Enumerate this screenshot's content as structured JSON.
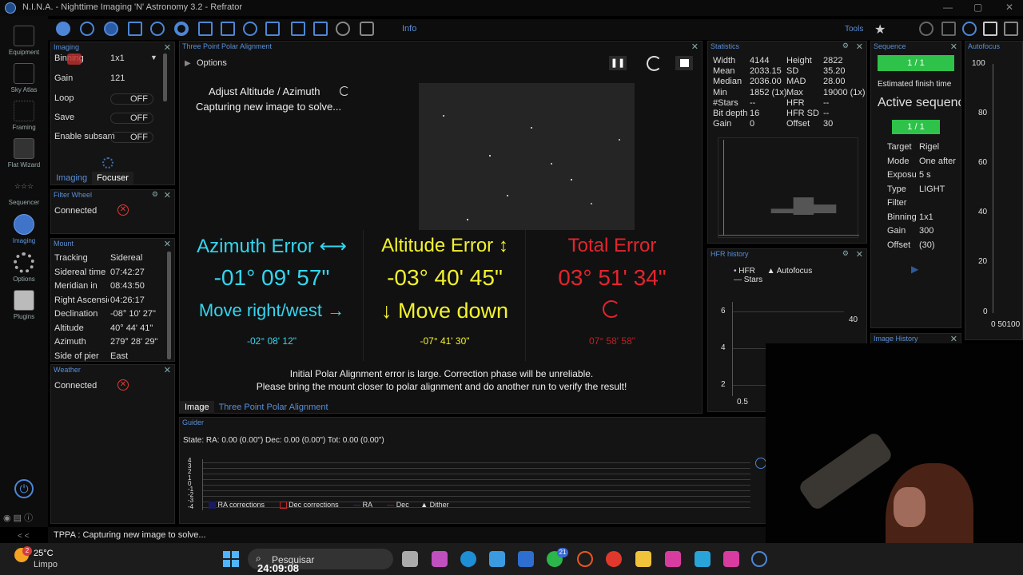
{
  "window": {
    "title": "N.I.N.A. - Nighttime Imaging 'N' Astronomy 3.2  -  Refrator"
  },
  "toolbar": {
    "tools_label": "Tools",
    "info_label": "Info"
  },
  "sidebar": {
    "items": [
      {
        "label": "Equipment",
        "icon": "telescope-icon"
      },
      {
        "label": "Sky Atlas",
        "icon": "sky-atlas-icon"
      },
      {
        "label": "Framing",
        "icon": "framing-icon"
      },
      {
        "label": "Flat Wizard",
        "icon": "flat-wizard-icon"
      },
      {
        "label": "Sequencer",
        "icon": "sequencer-icon"
      },
      {
        "label": "Imaging",
        "icon": "imaging-icon"
      },
      {
        "label": "Options",
        "icon": "gear-icon"
      },
      {
        "label": "Plugins",
        "icon": "puzzle-icon"
      }
    ],
    "collapse_label": "< <"
  },
  "imaging_panel": {
    "title": "Imaging",
    "rows": [
      {
        "key": "Binning",
        "value": "1x1"
      },
      {
        "key": "Gain",
        "value": "121"
      },
      {
        "key": "Loop",
        "value": "OFF"
      },
      {
        "key": "Save",
        "value": "OFF"
      },
      {
        "key": "Enable subsam",
        "value": "OFF"
      }
    ],
    "tabs": [
      "Imaging",
      "Focuser"
    ]
  },
  "filter_wheel": {
    "title": "Filter Wheel",
    "status": "Connected"
  },
  "mount": {
    "title": "Mount",
    "rows": [
      {
        "key": "Tracking",
        "value": "Sidereal"
      },
      {
        "key": "Sidereal time",
        "value": "07:42:27"
      },
      {
        "key": "Meridian in",
        "value": "08:43:50"
      },
      {
        "key": "Right Ascension",
        "value": "04:26:17"
      },
      {
        "key": "Declination",
        "value": "-08° 10' 27\""
      },
      {
        "key": "Altitude",
        "value": "40° 44' 41\""
      },
      {
        "key": "Azimuth",
        "value": "279° 28' 29\""
      },
      {
        "key": "Side of pier",
        "value": "East"
      }
    ]
  },
  "weather": {
    "title": "Weather",
    "status": "Connected"
  },
  "tppa": {
    "title": "Three Point Polar Alignment",
    "options_label": "Options",
    "step_title": "Adjust Altitude / Azimuth",
    "step_status": "Capturing new image to solve...",
    "azimuth": {
      "label": "Azimuth Error",
      "value": "-01° 09' 57\"",
      "move": "Move right/west",
      "sub": "-02° 08' 12\""
    },
    "altitude": {
      "label": "Altitude Error",
      "value": "-03° 40' 45\"",
      "move": "Move down",
      "sub": "-07° 41' 30\""
    },
    "total": {
      "label": "Total Error",
      "value": "03° 51' 34\"",
      "sub": "07° 58' 58\""
    },
    "warning_line1": "Initial Polar Alignment error is large. Correction phase will be unreliable.",
    "warning_line2": "Please bring the mount closer to polar alignment and do another run to verify the result!",
    "tabs": [
      "Image",
      "Three Point Polar Alignment"
    ]
  },
  "statistics": {
    "title": "Statistics",
    "left": [
      {
        "key": "Width",
        "value": "4144"
      },
      {
        "key": "Mean",
        "value": "2033.15"
      },
      {
        "key": "Median",
        "value": "2036.00"
      },
      {
        "key": "Min",
        "value": "1852 (1x)"
      },
      {
        "key": "#Stars",
        "value": "--"
      },
      {
        "key": "Bit depth",
        "value": "16"
      },
      {
        "key": "Gain",
        "value": "0"
      }
    ],
    "right": [
      {
        "key": "Height",
        "value": "2822"
      },
      {
        "key": "SD",
        "value": "35.20"
      },
      {
        "key": "MAD",
        "value": "28.00"
      },
      {
        "key": "Max",
        "value": "19000 (1x)"
      },
      {
        "key": "HFR",
        "value": "--"
      },
      {
        "key": "HFR SD",
        "value": "--"
      },
      {
        "key": "Offset",
        "value": "30"
      }
    ]
  },
  "hfr_history": {
    "title": "HFR history",
    "legend": [
      "HFR",
      "Autofocus",
      "Stars"
    ],
    "y_ticks": [
      "6",
      "4",
      "2"
    ],
    "x_tick": "0.5",
    "right_tick": "40"
  },
  "sequence": {
    "title": "Sequence",
    "progress": "1 / 1",
    "estimated": "Estimated finish time",
    "active": "Active sequence",
    "progress2": "1 / 1",
    "rows": [
      {
        "key": "Target",
        "value": "Rigel"
      },
      {
        "key": "Mode",
        "value": "One after another"
      },
      {
        "key": "Exposure",
        "value": "5 s"
      },
      {
        "key": "Type",
        "value": "LIGHT"
      },
      {
        "key": "Filter",
        "value": ""
      },
      {
        "key": "Binning",
        "value": "1x1"
      },
      {
        "key": "Gain",
        "value": "300"
      },
      {
        "key": "Offset",
        "value": "(30)"
      }
    ]
  },
  "image_history": {
    "title": "Image History"
  },
  "autofocus": {
    "title": "Autofocus",
    "y_ticks": [
      "100",
      "80",
      "60",
      "40",
      "20",
      "0"
    ],
    "x_ticks": "0 50100"
  },
  "guider": {
    "title": "Guider",
    "state": "State:  RA: 0.00 (0.00\")  Dec: 0.00 (0.00\")  Tot: 0.00 (0.00\")",
    "y_ticks": [
      "4",
      "3",
      "2",
      "1",
      "0",
      "-1",
      "-2",
      "-3",
      "-4"
    ],
    "legend": [
      "RA corrections",
      "Dec corrections",
      "RA",
      "Dec",
      "Dither"
    ]
  },
  "statusbar": {
    "text": "TPPA :  Capturing new image to solve..."
  },
  "taskbar": {
    "temp": "25°C",
    "weather": "Limpo",
    "search": "Pesquisar",
    "clock": "24:09:08",
    "badge": "2",
    "whatsapp_badge": "21"
  }
}
